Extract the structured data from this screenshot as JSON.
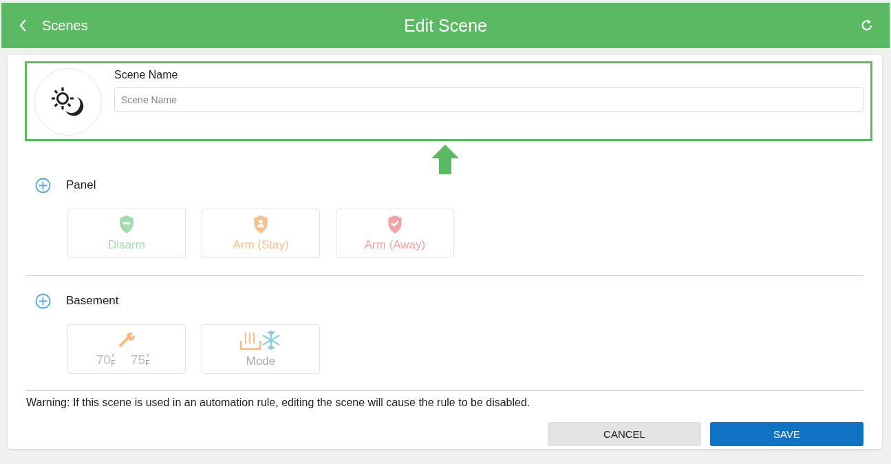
{
  "header": {
    "back_label": "Scenes",
    "title": "Edit Scene"
  },
  "scene_name": {
    "label": "Scene Name",
    "placeholder": "Scene Name"
  },
  "sections": [
    {
      "name": "Panel",
      "tiles": [
        {
          "kind": "disarm",
          "label": "Disarm",
          "color": "#a3dcae"
        },
        {
          "kind": "arm_stay",
          "label": "Arm (Stay)",
          "color": "#f6c08f"
        },
        {
          "kind": "arm_away",
          "label": "Arm (Away)",
          "color": "#f2a5a5"
        }
      ]
    },
    {
      "name": "Basement",
      "tiles": [
        {
          "kind": "thermostat",
          "low": "70",
          "low_unit": "°F",
          "high": "75",
          "high_unit": "°F"
        },
        {
          "kind": "mode",
          "label": "Mode"
        }
      ]
    }
  ],
  "warning": "Warning: If this scene is used in an automation rule, editing the scene will cause the rule to be disabled.",
  "buttons": [
    {
      "kind": "secondary",
      "label": "CANCEL"
    },
    {
      "kind": "primary",
      "label": "SAVE"
    }
  ]
}
